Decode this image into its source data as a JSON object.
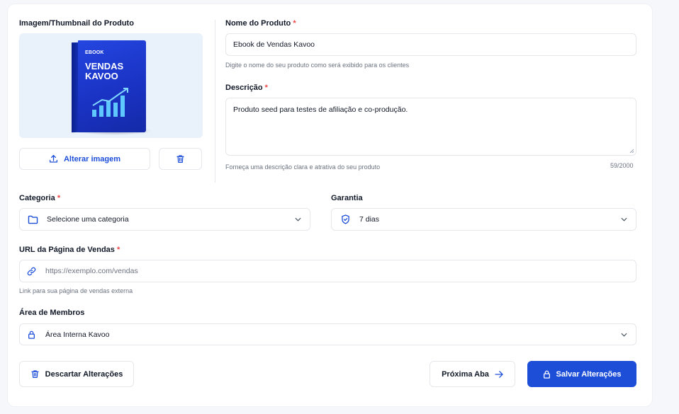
{
  "image_section": {
    "label": "Imagem/Thumbnail do Produto",
    "book_tag": "EBOOK",
    "book_title": "VENDAS KAVOO",
    "change_button": "Alterar imagem"
  },
  "product_name": {
    "label": "Nome do Produto",
    "required_mark": "*",
    "value": "Ebook de Vendas Kavoo",
    "hint": "Digite o nome do seu produto como será exibido para os clientes"
  },
  "description": {
    "label": "Descrição",
    "required_mark": "*",
    "value": "Produto seed para testes de afiliação e co-produção.",
    "hint": "Forneça uma descrição clara e atrativa do seu produto",
    "counter": "59/2000"
  },
  "category": {
    "label": "Categoria",
    "required_mark": "*",
    "placeholder": "Selecione uma categoria"
  },
  "guarantee": {
    "label": "Garantia",
    "value": "7 dias"
  },
  "sales_url": {
    "label": "URL da Página de Vendas",
    "required_mark": "*",
    "placeholder": "https://exemplo.com/vendas",
    "hint": "Link para sua página de vendas externa"
  },
  "members_area": {
    "label": "Área de Membros",
    "value": "Área Interna Kavoo"
  },
  "actions": {
    "discard": "Descartar Alterações",
    "next_tab": "Próxima Aba",
    "save": "Salvar Alterações"
  },
  "colors": {
    "primary": "#1d4ed8",
    "required": "#ef4444",
    "hint": "#6b7280",
    "border": "#e5e7eb"
  }
}
